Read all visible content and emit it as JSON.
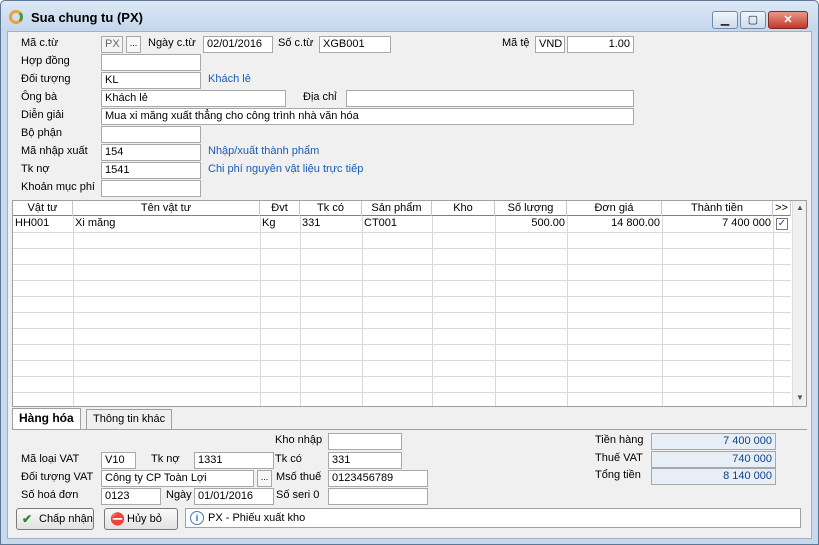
{
  "window": {
    "title": "Sua chung tu (PX)"
  },
  "header": {
    "ma_ct_label": "Mã c.từ",
    "ma_ct_value": "PX",
    "ma_ct_btn": "...",
    "ngay_ct_label": "Ngày c.từ",
    "ngay_ct_value": "02/01/2016",
    "so_ct_label": "Số c.từ",
    "so_ct_value": "XGB001",
    "ma_te_label": "Mã tệ",
    "ma_te_value": "VND",
    "ty_gia_value": "1.00",
    "hop_dong_label": "Hợp đồng",
    "hop_dong_value": "",
    "doi_tuong_label": "Đối tượng",
    "doi_tuong_value": "KL",
    "doi_tuong_hint": "Khách lẻ",
    "ong_ba_label": "Ông bà",
    "ong_ba_value": "Khách lẻ",
    "dia_chi_label": "Địa chỉ",
    "dia_chi_value": "",
    "dien_giai_label": "Diễn giải",
    "dien_giai_value": "Mua xi măng xuất thẳng cho công trình nhà văn hóa",
    "bo_phan_label": "Bộ phận",
    "bo_phan_value": "",
    "ma_nhap_xuat_label": "Mã nhập xuất",
    "ma_nhap_xuat_value": "154",
    "ma_nhap_xuat_hint": "Nhập/xuất thành phẩm",
    "tk_no_label": "Tk nợ",
    "tk_no_value": "1541",
    "tk_no_hint": "Chi phí nguyên vật liệu trực tiếp",
    "khoan_muc_label": "Khoản mục phí",
    "khoan_muc_value": ""
  },
  "grid": {
    "columns": [
      "Vật tư",
      "Tên vật tư",
      "Đvt",
      "Tk có",
      "Sản phẩm",
      "Kho",
      "Số lượng",
      "Đơn giá",
      "Thành tiền",
      ">>"
    ],
    "rows": [
      {
        "vat_tu": "HH001",
        "ten": "Xi măng",
        "dvt": "Kg",
        "tk_co": "331",
        "san_pham": "CT001",
        "kho": "",
        "so_luong": "500.00",
        "don_gia": "14 800.00",
        "thanh_tien": "7 400 000",
        "check": "✓"
      }
    ]
  },
  "tabs": [
    {
      "label": "Hàng hóa"
    },
    {
      "label": "Thông tin khác"
    }
  ],
  "footer": {
    "kho_nhap_label": "Kho nhập",
    "kho_nhap_value": "",
    "ma_loai_vat_label": "Mã loại VAT",
    "ma_loai_vat_value": "V10",
    "tk_no_label": "Tk nợ",
    "tk_no_value": "1331",
    "tk_co_label": "Tk có",
    "tk_co_value": "331",
    "doi_tuong_vat_label": "Đối tượng VAT",
    "doi_tuong_vat_value": "Công ty CP Toàn Lợi",
    "doi_tuong_vat_btn": "...",
    "ms_thue_label": "Msố thuế",
    "ms_thue_value": "0123456789",
    "so_hoa_don_label": "Số hoá đơn",
    "so_hoa_don_value": "0123",
    "ngay_label": "Ngày",
    "ngay_value": "01/01/2016",
    "so_seri_label": "Số seri 0",
    "so_seri_value": "",
    "tien_hang_label": "Tiền hàng",
    "tien_hang_value": "7 400 000",
    "thue_vat_label": "Thuế VAT",
    "thue_vat_value": "740 000",
    "tong_tien_label": "Tổng tiền",
    "tong_tien_value": "8 140 000"
  },
  "buttons": {
    "accept": "Chấp nhận",
    "cancel": "Hủy bỏ"
  },
  "status": {
    "text": "PX - Phiếu xuất kho"
  },
  "icons": {
    "accept": "check-icon",
    "cancel": "stop-icon",
    "info": "info-icon",
    "app": "app-logo-icon"
  }
}
